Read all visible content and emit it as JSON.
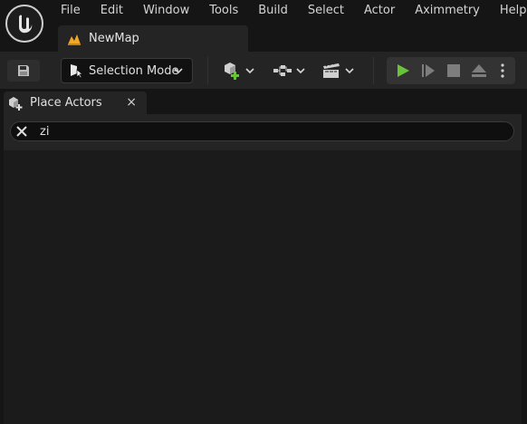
{
  "menu": {
    "items": [
      "File",
      "Edit",
      "Window",
      "Tools",
      "Build",
      "Select",
      "Actor",
      "Aximmetry",
      "Help"
    ]
  },
  "document_tab": {
    "label": "NewMap",
    "icon": "level-icon"
  },
  "toolbar": {
    "save_icon": "save-icon",
    "selection_mode_label": "Selection Mode",
    "add_actor_icon": "add-actor-icon",
    "blueprint_icon": "blueprint-icon",
    "cinematics_icon": "clapperboard-icon",
    "play_icon": "play-icon",
    "advance_frame_icon": "advance-frame-icon",
    "stop_icon": "stop-icon",
    "eject_icon": "eject-icon",
    "options_icon": "more-options-icon"
  },
  "panel": {
    "title": "Place Actors",
    "close_glyph": "×",
    "search": {
      "value": "zi",
      "placeholder": ""
    }
  },
  "colors": {
    "accent_orange": "#f5a623",
    "play_green": "#6ac23a",
    "background": "#151515",
    "panel": "#242424"
  }
}
